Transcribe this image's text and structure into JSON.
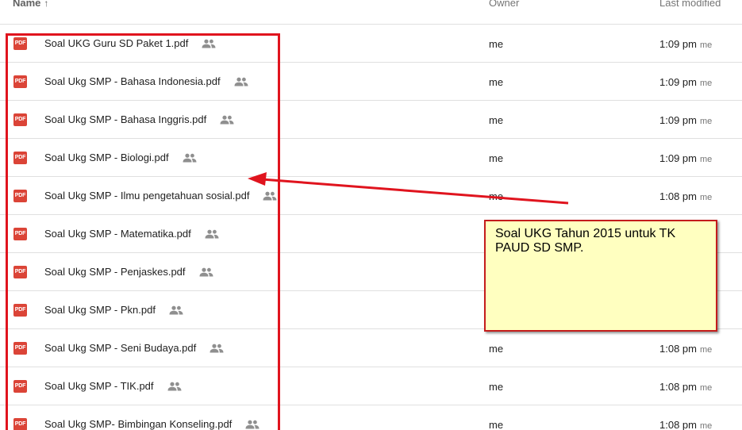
{
  "header": {
    "name_label": "Name",
    "sort_arrow": "↑",
    "owner_label": "Owner",
    "modified_label": "Last modified"
  },
  "files": [
    {
      "name": "Soal UKG Guru SD Paket 1.pdf",
      "owner": "me",
      "time": "1:09 pm",
      "by": "me"
    },
    {
      "name": "Soal Ukg SMP - Bahasa Indonesia.pdf",
      "owner": "me",
      "time": "1:09 pm",
      "by": "me"
    },
    {
      "name": "Soal Ukg SMP - Bahasa Inggris.pdf",
      "owner": "me",
      "time": "1:09 pm",
      "by": "me"
    },
    {
      "name": "Soal Ukg SMP - Biologi.pdf",
      "owner": "me",
      "time": "1:09 pm",
      "by": "me"
    },
    {
      "name": "Soal Ukg SMP - Ilmu pengetahuan sosial.pdf",
      "owner": "me",
      "time": "1:08 pm",
      "by": "me"
    },
    {
      "name": "Soal Ukg SMP - Matematika.pdf",
      "owner": "",
      "time": "",
      "by": ""
    },
    {
      "name": "Soal Ukg SMP - Penjaskes.pdf",
      "owner": "",
      "time": "",
      "by": ""
    },
    {
      "name": "Soal Ukg SMP - Pkn.pdf",
      "owner": "",
      "time": "",
      "by": ""
    },
    {
      "name": "Soal Ukg SMP - Seni Budaya.pdf",
      "owner": "me",
      "time": "1:08 pm",
      "by": "me"
    },
    {
      "name": "Soal Ukg SMP - TIK.pdf",
      "owner": "me",
      "time": "1:08 pm",
      "by": "me"
    },
    {
      "name": "Soal Ukg SMP- Bimbingan Konseling.pdf",
      "owner": "me",
      "time": "1:08 pm",
      "by": "me"
    }
  ],
  "file_icon_text": "PDF",
  "note": {
    "text": "Soal UKG Tahun 2015 untuk TK PAUD SD SMP."
  },
  "colors": {
    "annotation_red": "#e0141e",
    "note_background": "#ffffc0",
    "pdf_icon": "#db4437"
  }
}
